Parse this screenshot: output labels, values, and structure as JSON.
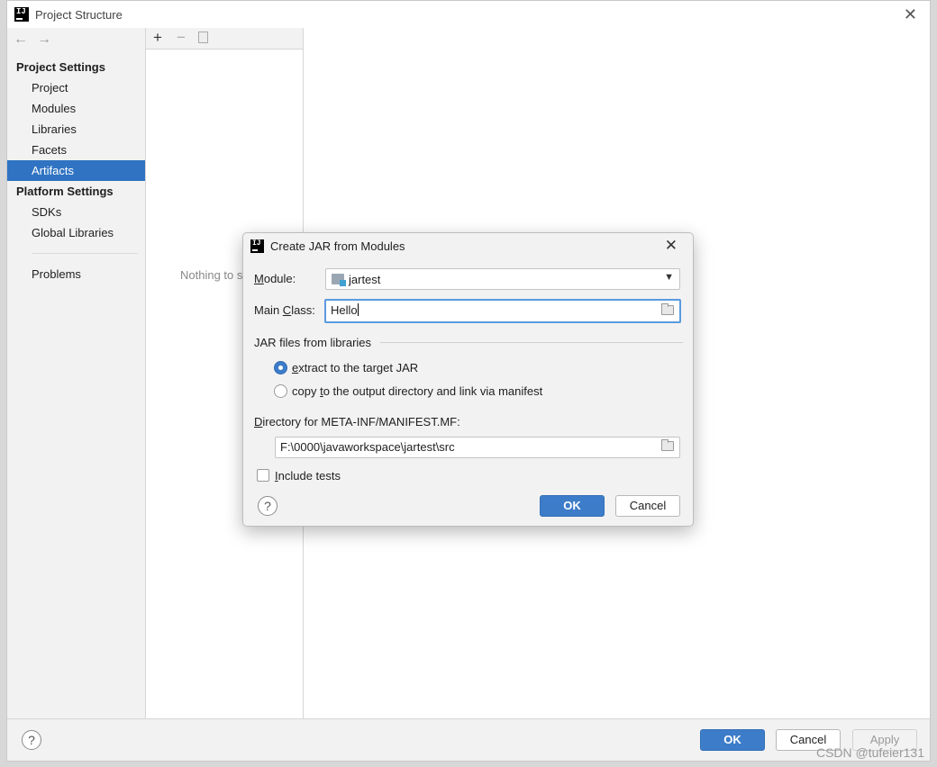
{
  "window": {
    "title": "Project Structure",
    "app_logo": "IJ"
  },
  "sidebar": {
    "project_settings_header": "Project Settings",
    "project_items": [
      {
        "label": "Project"
      },
      {
        "label": "Modules"
      },
      {
        "label": "Libraries"
      },
      {
        "label": "Facets"
      },
      {
        "label": "Artifacts",
        "selected": true
      }
    ],
    "platform_settings_header": "Platform Settings",
    "platform_items": [
      {
        "label": "SDKs"
      },
      {
        "label": "Global Libraries"
      }
    ],
    "problems_label": "Problems"
  },
  "middle": {
    "empty_text": "Nothing to s"
  },
  "bottom": {
    "ok_label": "OK",
    "cancel_label": "Cancel",
    "apply_label": "Apply"
  },
  "dialog": {
    "title": "Create JAR from Modules",
    "module_label_accel": "M",
    "module_label_rest": "odule:",
    "module_value": "jartest",
    "main_class_label_pre": "Main ",
    "main_class_label_accel": "C",
    "main_class_label_post": "lass:",
    "main_class_value": "Hello",
    "jar_group_label": "JAR files from libraries",
    "radio_extract_accel": "e",
    "radio_extract_rest": "xtract to the target JAR",
    "radio_copy_pre": "copy ",
    "radio_copy_accel": "t",
    "radio_copy_post": "o the output directory and link via manifest",
    "manifest_dir_label_accel": "D",
    "manifest_dir_label_rest": "irectory for META-INF/MANIFEST.MF:",
    "manifest_dir_value": "F:\\0000\\javaworkspace\\jartest\\src",
    "include_tests_accel": "I",
    "include_tests_rest": "nclude tests",
    "include_tests_checked": false,
    "ok_label": "OK",
    "cancel_label": "Cancel"
  },
  "watermark": "CSDN @tufeier131",
  "colors": {
    "accent": "#2f73c2",
    "primary_button": "#3d7cc9",
    "focus_ring": "#5b9ae0"
  }
}
